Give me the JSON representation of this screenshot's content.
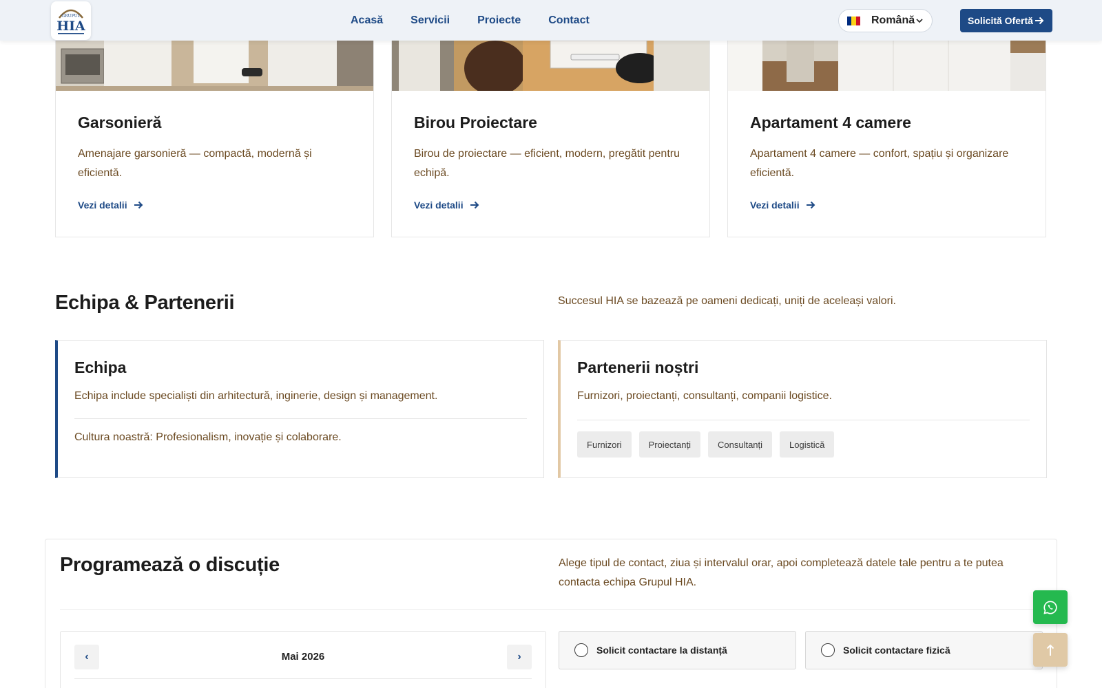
{
  "header": {
    "logo_text_small": "GRUPUL",
    "logo_text": "HIA",
    "nav": [
      "Acasă",
      "Servicii",
      "Proiecte",
      "Contact"
    ],
    "language": "Română",
    "cta": "Solicită Ofertă"
  },
  "projects": [
    {
      "title": "Garsonieră",
      "desc": "Amenajare garsonieră — compactă, modernă și eficientă.",
      "link": "Vezi detalii"
    },
    {
      "title": "Birou Proiectare",
      "desc": "Birou de proiectare — eficient, modern, pregătit pentru echipă.",
      "link": "Vezi detalii"
    },
    {
      "title": "Apartament 4 camere",
      "desc": "Apartament 4 camere — confort, spațiu și organizare eficientă.",
      "link": "Vezi detalii"
    }
  ],
  "team_section": {
    "title": "Echipa & Partenerii",
    "lead": "Succesul HIA se bazează pe oameni dedicați, uniți de aceleași valori.",
    "team": {
      "title": "Echipa",
      "text": "Echipa include specialiști din arhitectură, inginerie, design și management.",
      "culture": "Cultura noastră: Profesionalism, inovație și colaborare."
    },
    "partners": {
      "title": "Partenerii noștri",
      "text": "Furnizori, proiectanți, consultanți, companii logistice.",
      "chips": [
        "Furnizori",
        "Proiectanți",
        "Consultanți",
        "Logistică"
      ]
    }
  },
  "schedule": {
    "title": "Programează o discuție",
    "lead": "Alege tipul de contact, ziua și intervalul orar, apoi completează datele tale pentru a te putea contacta echipa Grupul HIA.",
    "calendar": {
      "month": "Mai 2026",
      "prev": "‹",
      "next": "›"
    },
    "options": [
      "Solicit contactare la distanță",
      "Solicit contactare fizică"
    ]
  },
  "colors": {
    "brand_blue": "#1e4a86",
    "accent_beige": "#e2c8a4",
    "text_brown": "#6b4a22",
    "whatsapp_green": "#25b94f"
  },
  "icons": {
    "whatsapp": "whatsapp-icon",
    "scroll_top": "arrow-up-icon",
    "arrow": "arrow-right-icon",
    "dropdown": "chevron-down-icon"
  }
}
